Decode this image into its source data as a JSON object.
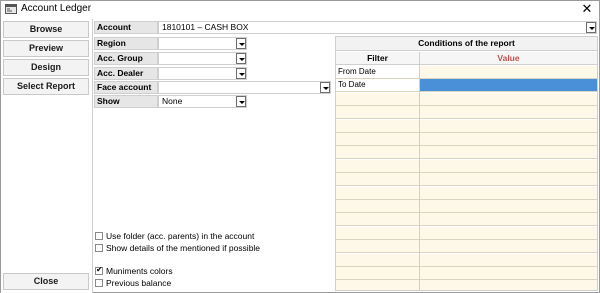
{
  "window": {
    "title": "Account Ledger",
    "close_glyph": "✕"
  },
  "nav": {
    "browse": "Browse",
    "preview": "Preview",
    "design": "Design",
    "select_report": "Select Report",
    "close": "Close"
  },
  "form": {
    "account": {
      "label": "Account",
      "value": "1810101 – CASH BOX"
    },
    "region": {
      "label": "Region",
      "value": ""
    },
    "acc_group": {
      "label": "Acc. Group",
      "value": ""
    },
    "acc_dealer": {
      "label": "Acc. Dealer",
      "value": ""
    },
    "face_account": {
      "label": "Face account",
      "value": ""
    },
    "show": {
      "label": "Show",
      "value": "None"
    }
  },
  "options": {
    "use_folder": {
      "label": "Use folder (acc. parents)  in the account",
      "checked": false
    },
    "show_details": {
      "label": "Show details of the mentioned if possible",
      "checked": false
    },
    "muniments_colors": {
      "label": "Muniments colors",
      "checked": true
    },
    "previous_balance": {
      "label": "Previous balance",
      "checked": false
    }
  },
  "conditions": {
    "title": "Conditions of the report",
    "filter_header": "Filter",
    "value_header": "Value",
    "rows": [
      {
        "filter": "From Date",
        "value": ""
      },
      {
        "filter": "To Date",
        "value": ""
      },
      {
        "filter": "",
        "value": ""
      },
      {
        "filter": "",
        "value": ""
      },
      {
        "filter": "",
        "value": ""
      },
      {
        "filter": "",
        "value": ""
      },
      {
        "filter": "",
        "value": ""
      },
      {
        "filter": "",
        "value": ""
      },
      {
        "filter": "",
        "value": ""
      },
      {
        "filter": "",
        "value": ""
      },
      {
        "filter": "",
        "value": ""
      },
      {
        "filter": "",
        "value": ""
      },
      {
        "filter": "",
        "value": ""
      },
      {
        "filter": "",
        "value": ""
      },
      {
        "filter": "",
        "value": ""
      },
      {
        "filter": "",
        "value": ""
      },
      {
        "filter": "",
        "value": ""
      }
    ]
  },
  "colors": {
    "value_header": "#c0504d",
    "selected_cell": "#4a90d9",
    "row_fill": "#fdf8e8",
    "label_bg": "#e6e6e6"
  }
}
